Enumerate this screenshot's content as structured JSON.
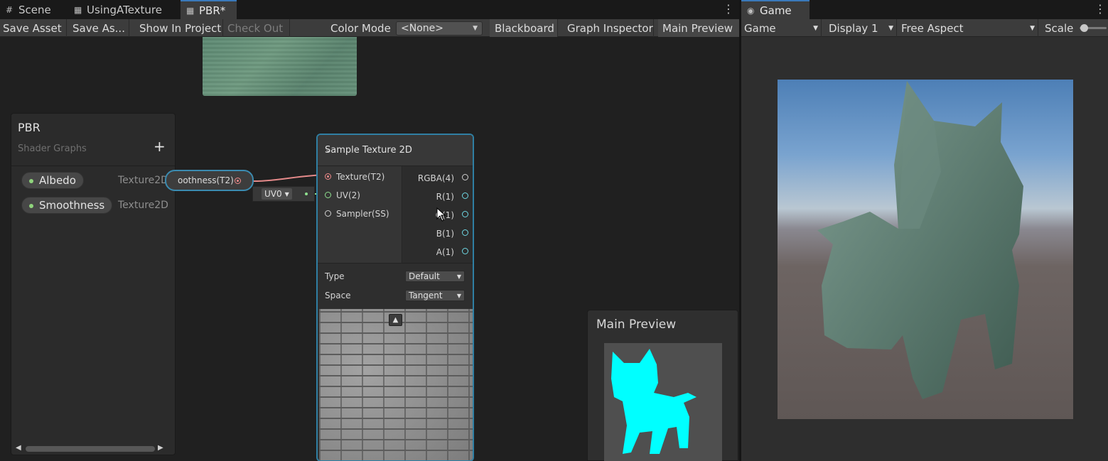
{
  "left_tabs": [
    {
      "label": "Scene",
      "icon": "grid-icon"
    },
    {
      "label": "UsingATexture",
      "icon": "shader-icon"
    },
    {
      "label": "PBR*",
      "icon": "shader-icon",
      "active": true
    }
  ],
  "right_tabs": [
    {
      "label": "Game",
      "icon": "gamepad-icon",
      "active": true
    }
  ],
  "graph_toolbar": {
    "save_asset": "Save Asset",
    "save_as": "Save As...",
    "show_in_project": "Show In Project",
    "check_out": "Check Out",
    "color_mode_label": "Color Mode",
    "color_mode_value": "<None>",
    "blackboard": "Blackboard",
    "graph_inspector": "Graph Inspector",
    "main_preview": "Main Preview"
  },
  "game_toolbar": {
    "view_mode": "Game",
    "display": "Display 1",
    "aspect": "Free Aspect",
    "scale_label": "Scale",
    "scale_value": 0.05
  },
  "blackboard": {
    "title": "PBR",
    "subtitle": "Shader Graphs",
    "add_symbol": "+",
    "properties": [
      {
        "name": "Albedo",
        "type": "Texture2D"
      },
      {
        "name": "Smoothness",
        "type": "Texture2D"
      }
    ]
  },
  "property_node": {
    "label": "oothness(T2)"
  },
  "uv_node": {
    "label": "UV0"
  },
  "sample_node": {
    "title": "Sample Texture 2D",
    "inputs": [
      "Texture(T2)",
      "UV(2)",
      "Sampler(SS)"
    ],
    "outputs": [
      "RGBA(4)",
      "R(1)",
      "G(1)",
      "B(1)",
      "A(1)"
    ],
    "type_label": "Type",
    "type_value": "Default",
    "space_label": "Space",
    "space_value": "Tangent"
  },
  "main_preview": {
    "title": "Main Preview"
  },
  "colors": {
    "accent": "#3a79bb",
    "node_border": "#2f7fa3",
    "edge_texture": "#e58a8a",
    "edge_uv": "#8fe08f",
    "preview_cat": "#00ffff"
  }
}
